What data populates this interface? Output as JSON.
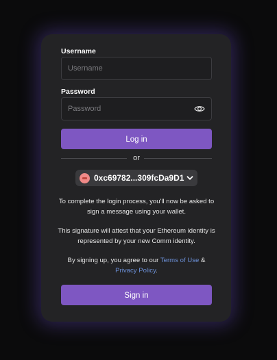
{
  "username": {
    "label": "Username",
    "placeholder": "Username",
    "value": ""
  },
  "password": {
    "label": "Password",
    "placeholder": "Password",
    "value": ""
  },
  "login_button": "Log in",
  "divider_text": "or",
  "wallet": {
    "address": "0xc69782...309fcDa9D1"
  },
  "info": {
    "line1": "To complete the login process, you'll now be asked to sign a message using your wallet.",
    "line2": "This signature will attest that your Ethereum identity is represented by your new Comm identity.",
    "terms_prefix": "By signing up, you agree to our ",
    "terms_link": "Terms of Use",
    "terms_amp": " & ",
    "privacy_link": "Privacy Policy",
    "terms_suffix": "."
  },
  "signin_button": "Sign in",
  "colors": {
    "accent": "#7e57c2",
    "link": "#6b8fd6",
    "card": "#232325"
  },
  "icons": {
    "password_toggle": "eye-icon",
    "wallet_dropdown": "chevron-down-icon"
  }
}
